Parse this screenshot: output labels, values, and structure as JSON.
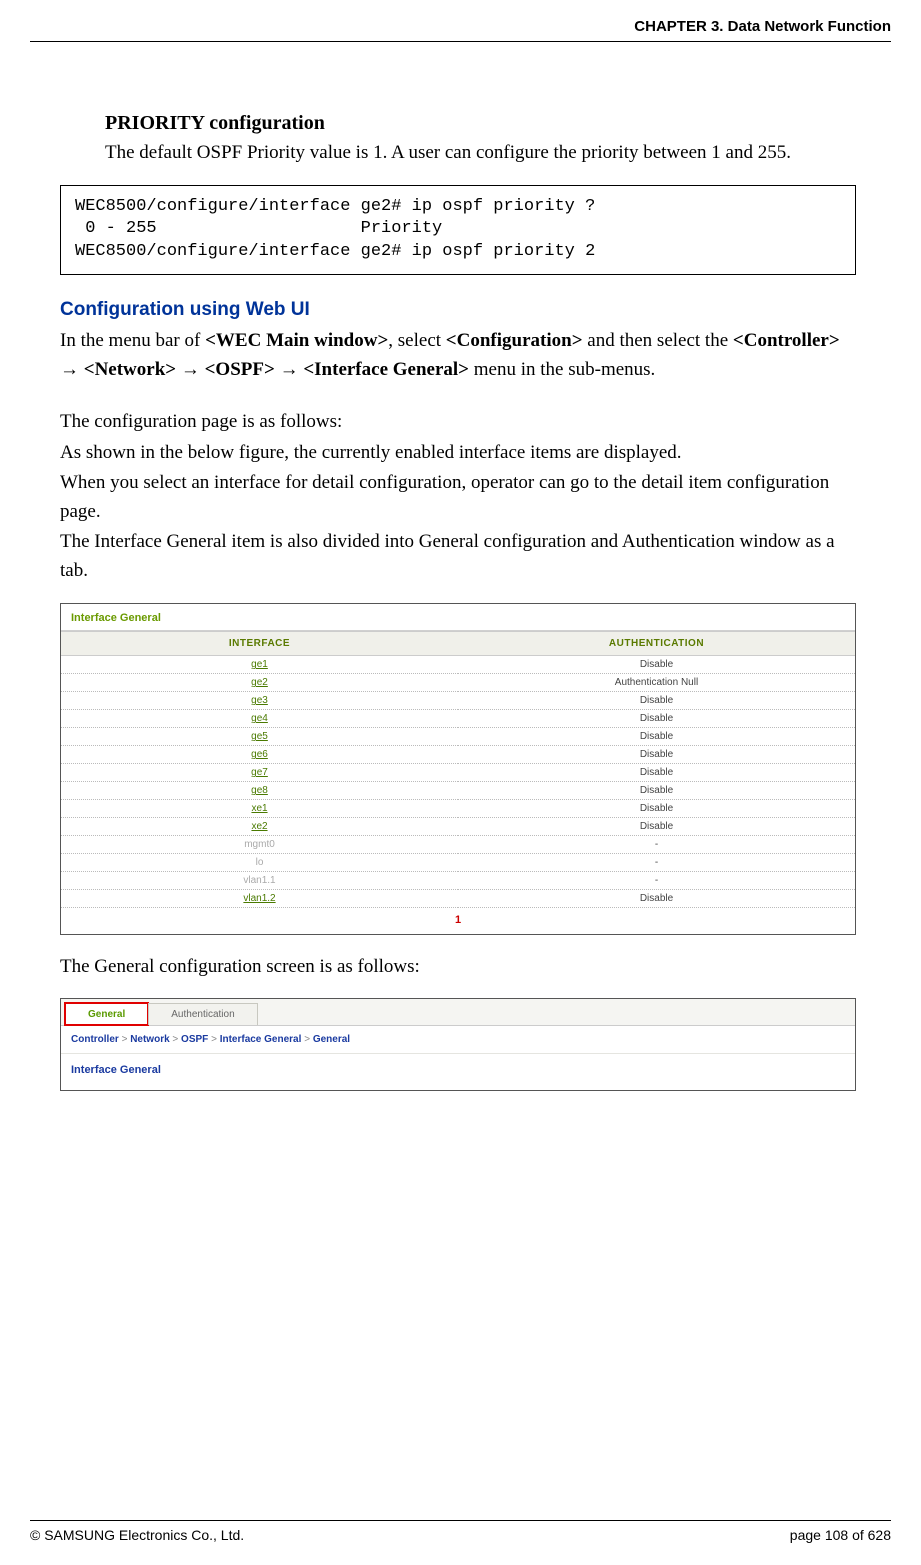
{
  "header": {
    "chapter": "CHAPTER 3. Data Network Function"
  },
  "sec": {
    "priority_title": "PRIORITY configuration",
    "priority_desc": "The default OSPF Priority value is 1. A user can configure the priority between 1 and 255."
  },
  "code": {
    "block": "WEC8500/configure/interface ge2# ip ospf priority ?\n 0 - 255                    Priority\nWEC8500/configure/interface ge2# ip ospf priority 2"
  },
  "webui": {
    "heading": "Configuration using Web UI",
    "p1a": "In the menu bar of ",
    "p1b": "<WEC Main window>",
    "p1c": ", select ",
    "p1d": "<Configuration>",
    "p1e": " and then select the ",
    "p1f": "<Controller>",
    "p1g": "<Network>",
    "p1h": "<OSPF>",
    "p1i": "<Interface General>",
    "p1j": " menu in the sub-menus.",
    "arrow": "→",
    "p2": "The configuration page is as follows:",
    "p3": "As shown in the below figure, the currently enabled interface items are displayed.",
    "p4": "When you select an interface for detail configuration, operator can go to the detail item configuration page.",
    "p5": "The Interface General item is also divided into General configuration and Authentication window as a tab.",
    "p6": "The General configuration screen is as follows:"
  },
  "fig1": {
    "title": "Interface General",
    "col_interface": "INTERFACE",
    "col_auth": "AUTHENTICATION",
    "rows": [
      {
        "iface": "ge1",
        "auth": "Disable",
        "link": true
      },
      {
        "iface": "ge2",
        "auth": "Authentication Null",
        "link": true
      },
      {
        "iface": "ge3",
        "auth": "Disable",
        "link": true
      },
      {
        "iface": "ge4",
        "auth": "Disable",
        "link": true
      },
      {
        "iface": "ge5",
        "auth": "Disable",
        "link": true
      },
      {
        "iface": "ge6",
        "auth": "Disable",
        "link": true
      },
      {
        "iface": "ge7",
        "auth": "Disable",
        "link": true
      },
      {
        "iface": "ge8",
        "auth": "Disable",
        "link": true
      },
      {
        "iface": "xe1",
        "auth": "Disable",
        "link": true
      },
      {
        "iface": "xe2",
        "auth": "Disable",
        "link": true
      },
      {
        "iface": "mgmt0",
        "auth": "-",
        "link": false
      },
      {
        "iface": "lo",
        "auth": "-",
        "link": false
      },
      {
        "iface": "vlan1.1",
        "auth": "-",
        "link": false
      },
      {
        "iface": "vlan1.2",
        "auth": "Disable",
        "link": true
      }
    ],
    "pager": "1"
  },
  "fig2": {
    "tab_general": "General",
    "tab_auth": "Authentication",
    "crumb": {
      "a": "Controller",
      "b": "Network",
      "c": "OSPF",
      "d": "Interface General",
      "e": "General",
      "sep": ">"
    },
    "section": "Interface General"
  },
  "footer": {
    "left": "© SAMSUNG Electronics Co., Ltd.",
    "right": "page 108 of 628"
  }
}
